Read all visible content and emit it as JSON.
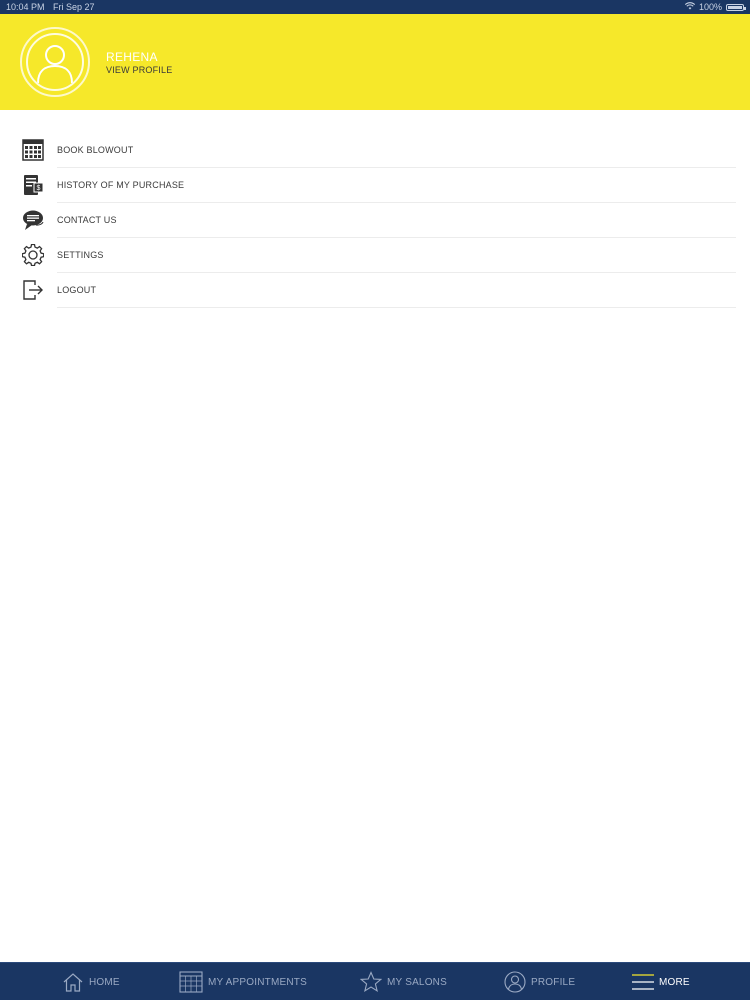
{
  "status_bar": {
    "time": "10:04 PM",
    "date": "Fri Sep 27",
    "battery": "100%",
    "wifi_icon": "wifi-icon",
    "battery_icon": "battery-icon"
  },
  "header": {
    "background_color": "#f6e82a",
    "user_name": "REHENA",
    "view_profile": "VIEW PROFILE",
    "avatar_icon": "user-avatar-icon"
  },
  "menu": {
    "items": [
      {
        "label": "BOOK BLOWOUT",
        "icon": "calendar-grid-icon"
      },
      {
        "label": "HISTORY OF MY PURCHASE",
        "icon": "receipt-history-icon"
      },
      {
        "label": "CONTACT US",
        "icon": "chat-bubble-icon"
      },
      {
        "label": "SETTINGS",
        "icon": "gear-icon"
      },
      {
        "label": "LOGOUT",
        "icon": "logout-icon"
      }
    ]
  },
  "tab_bar": {
    "background_color": "#1a3663",
    "tabs": [
      {
        "label": "HOME",
        "icon": "home-icon",
        "active": false
      },
      {
        "label": "MY APPOINTMENTS",
        "icon": "calendar-icon",
        "active": false
      },
      {
        "label": "MY SALONS",
        "icon": "star-icon",
        "active": false
      },
      {
        "label": "PROFILE",
        "icon": "profile-icon",
        "active": false
      },
      {
        "label": "MORE",
        "icon": "menu-lines-icon",
        "active": true
      }
    ]
  }
}
